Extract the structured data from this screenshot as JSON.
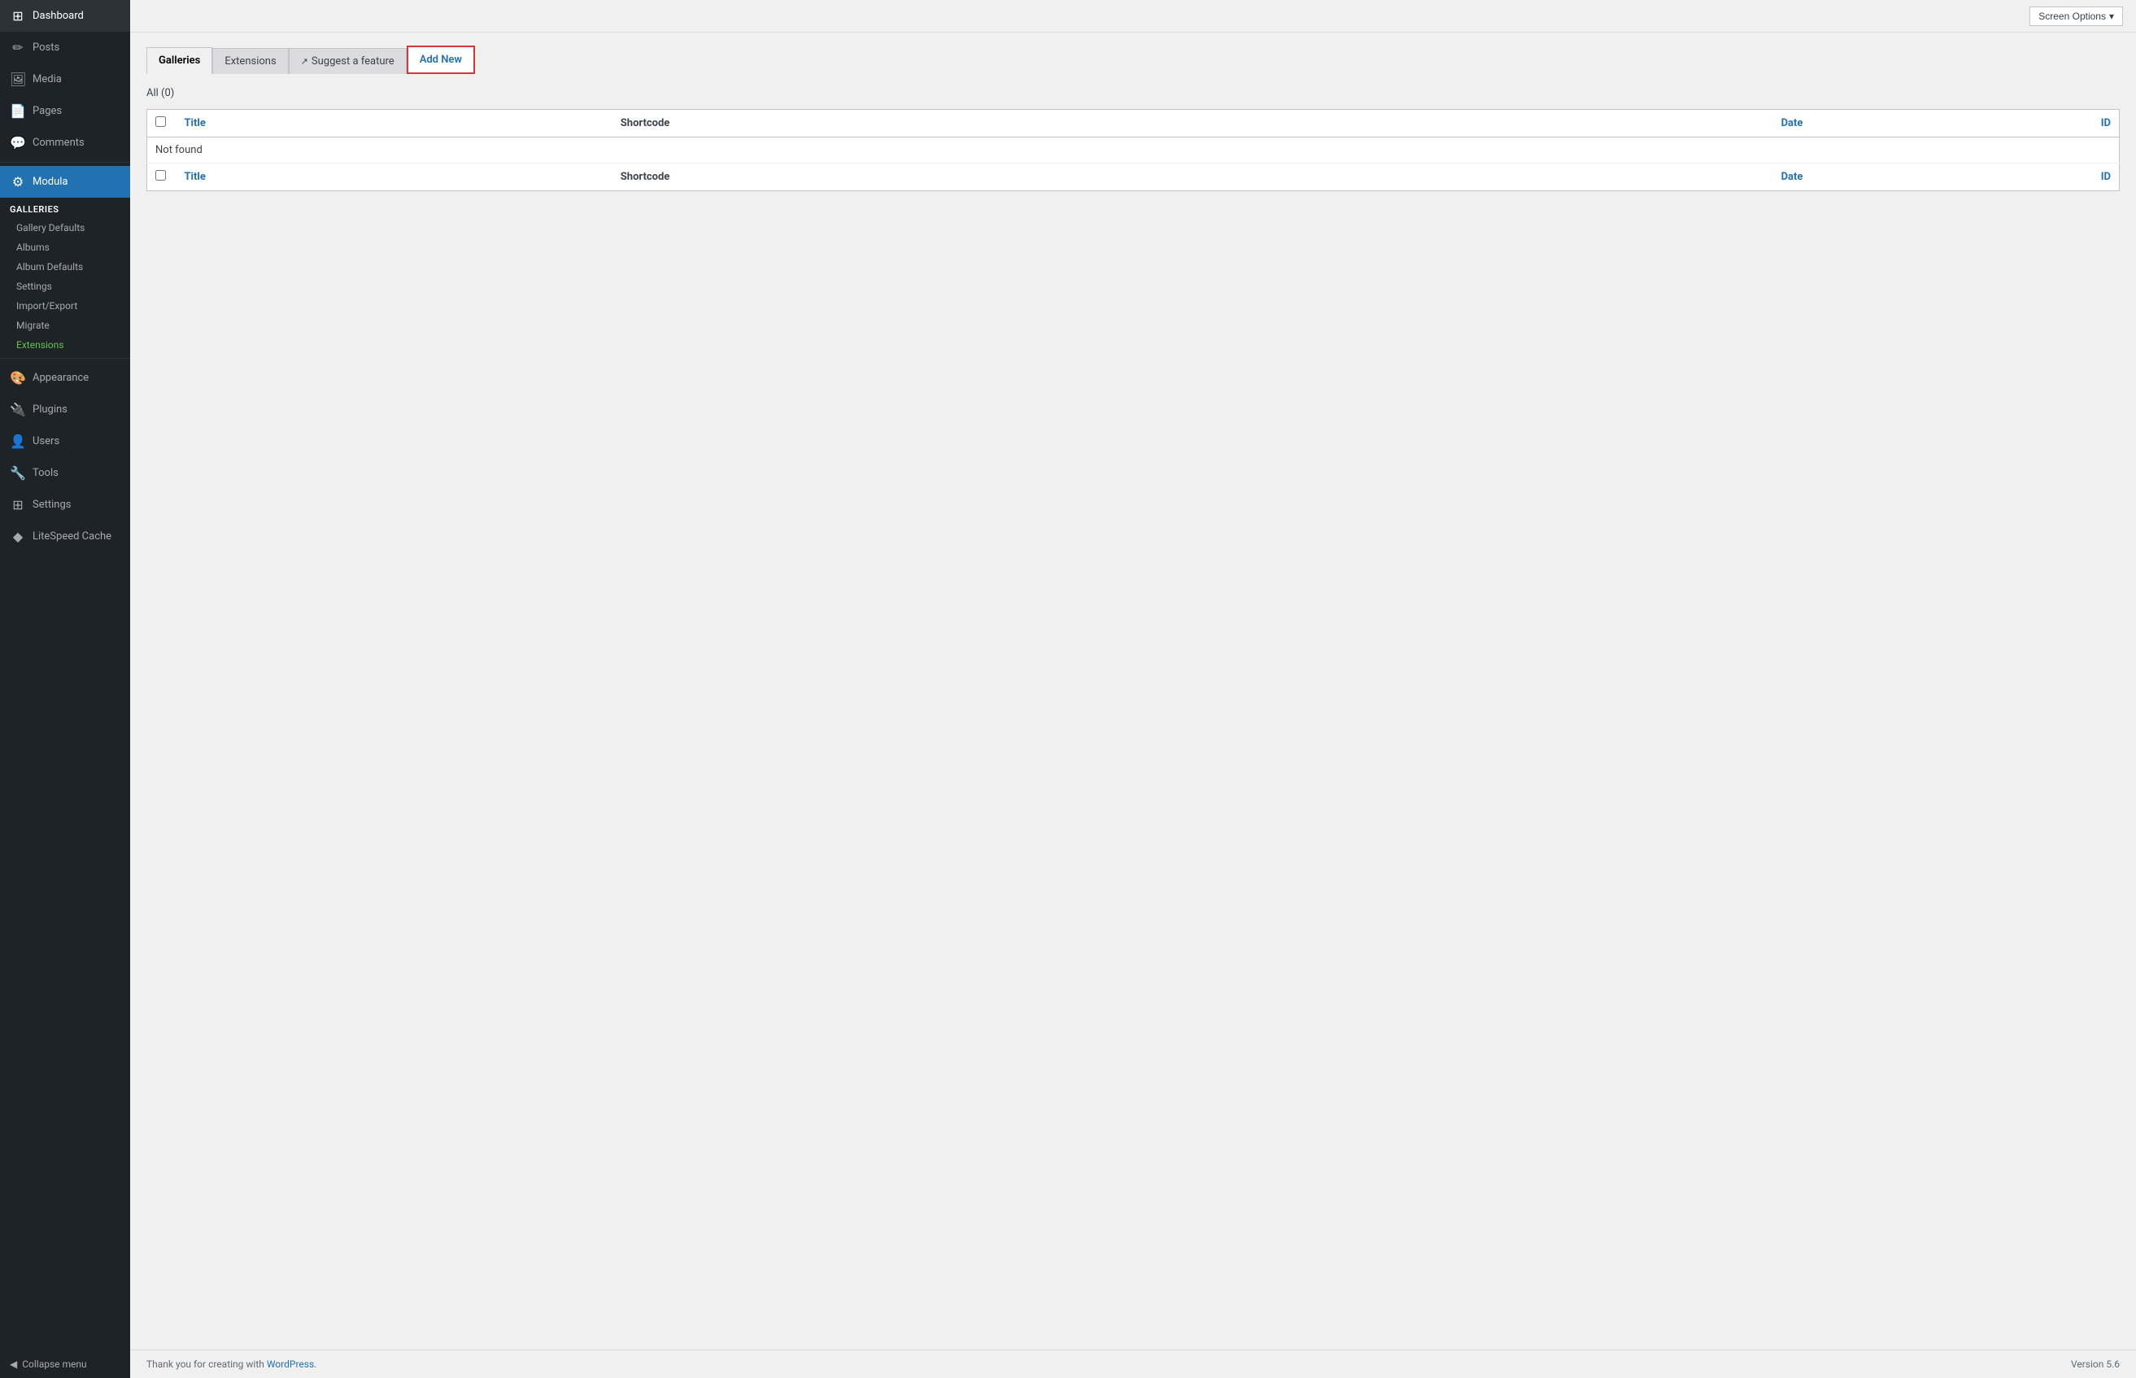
{
  "sidebar": {
    "items": [
      {
        "id": "dashboard",
        "label": "Dashboard",
        "icon": "⊞"
      },
      {
        "id": "posts",
        "label": "Posts",
        "icon": "📝"
      },
      {
        "id": "media",
        "label": "Media",
        "icon": "🖼"
      },
      {
        "id": "pages",
        "label": "Pages",
        "icon": "📄"
      },
      {
        "id": "comments",
        "label": "Comments",
        "icon": "💬"
      },
      {
        "id": "modula",
        "label": "Modula",
        "icon": "⚙"
      }
    ],
    "galleries_section": "Galleries",
    "galleries_sub": [
      {
        "id": "gallery-defaults",
        "label": "Gallery Defaults",
        "active": false
      },
      {
        "id": "albums",
        "label": "Albums",
        "active": false
      },
      {
        "id": "album-defaults",
        "label": "Album Defaults",
        "active": false
      },
      {
        "id": "settings",
        "label": "Settings",
        "active": false
      },
      {
        "id": "import-export",
        "label": "Import/Export",
        "active": false
      },
      {
        "id": "migrate",
        "label": "Migrate",
        "active": false
      },
      {
        "id": "extensions",
        "label": "Extensions",
        "active": true,
        "green": true
      }
    ],
    "bottom_items": [
      {
        "id": "appearance",
        "label": "Appearance",
        "icon": "🎨"
      },
      {
        "id": "plugins",
        "label": "Plugins",
        "icon": "🔌"
      },
      {
        "id": "users",
        "label": "Users",
        "icon": "👤"
      },
      {
        "id": "tools",
        "label": "Tools",
        "icon": "🔧"
      },
      {
        "id": "settings",
        "label": "Settings",
        "icon": "⊞"
      },
      {
        "id": "litespeed",
        "label": "LiteSpeed Cache",
        "icon": "◆"
      }
    ],
    "collapse_label": "Collapse menu"
  },
  "topbar": {
    "screen_options_label": "Screen Options",
    "screen_options_arrow": "▾"
  },
  "tabs": [
    {
      "id": "galleries",
      "label": "Galleries",
      "active": true
    },
    {
      "id": "extensions",
      "label": "Extensions",
      "active": false
    },
    {
      "id": "suggest",
      "label": "Suggest a feature",
      "active": false,
      "external": true
    },
    {
      "id": "add-new",
      "label": "Add New",
      "active": false,
      "highlight": true
    }
  ],
  "filter": {
    "all_label": "All",
    "count": "(0)"
  },
  "table": {
    "columns": {
      "title": "Title",
      "shortcode": "Shortcode",
      "date": "Date",
      "id": "ID"
    },
    "not_found": "Not found",
    "rows": []
  },
  "footer": {
    "thank_you_text": "Thank you for creating with",
    "wp_link_text": "WordPress",
    "version_text": "Version 5.6"
  }
}
